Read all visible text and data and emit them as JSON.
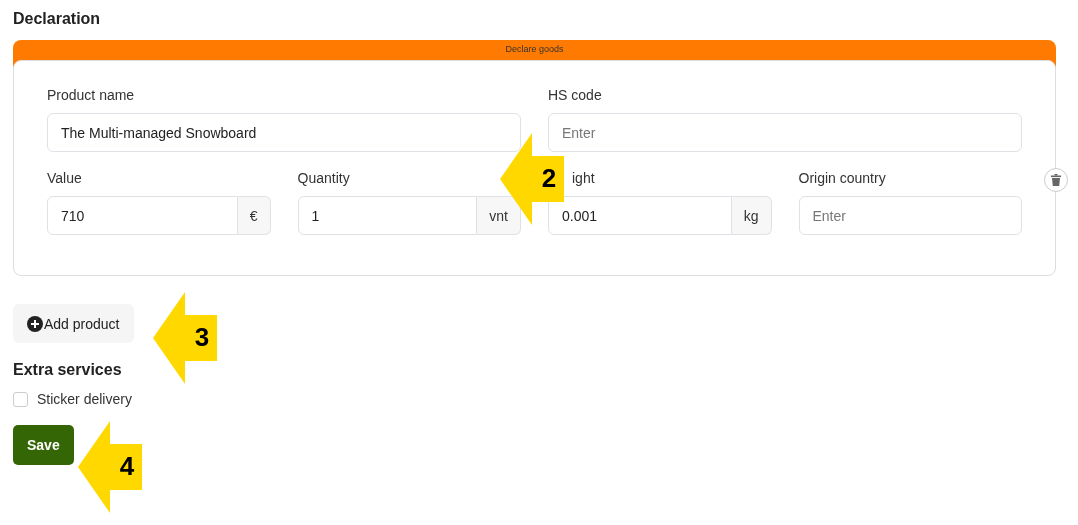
{
  "heading": "Declaration",
  "card": {
    "header": "Declare goods",
    "rows": [
      {
        "fields": [
          {
            "label": "Product name",
            "value": "The Multi-managed Snowboard"
          },
          {
            "label": "HS code",
            "placeholder": "Enter"
          }
        ]
      },
      {
        "fields": [
          {
            "label": "Value",
            "value": "710",
            "unit": "€"
          },
          {
            "label": "Quantity",
            "value": "1",
            "unit": "vnt"
          },
          {
            "label": "ight",
            "value": "0.001",
            "unit": "kg"
          },
          {
            "label": "Origin country",
            "placeholder": "Enter"
          }
        ]
      }
    ]
  },
  "add_button": "Add product",
  "extra": {
    "title": "Extra services",
    "options": [
      {
        "label": "Sticker delivery",
        "checked": false
      }
    ]
  },
  "save_button": "Save",
  "callouts": [
    {
      "number": "2"
    },
    {
      "number": "3"
    },
    {
      "number": "4"
    }
  ]
}
